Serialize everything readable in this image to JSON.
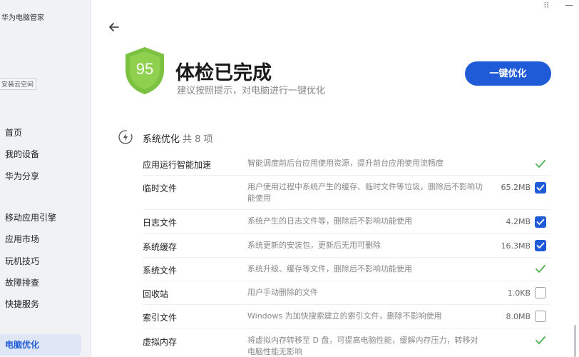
{
  "app": {
    "title": "华为电脑管家",
    "cloud_tag": "安装云空间"
  },
  "sidebar": {
    "items": [
      {
        "label": "首页"
      },
      {
        "label": "我的设备"
      },
      {
        "label": "华为分享"
      },
      {
        "label": "移动应用引擎"
      },
      {
        "label": "应用市场"
      },
      {
        "label": "玩机技巧"
      },
      {
        "label": "故障排查"
      },
      {
        "label": "快捷服务"
      },
      {
        "label": "电脑优化",
        "active": true
      }
    ]
  },
  "checkup": {
    "score": "95",
    "title": "体检已完成",
    "subtitle": "建议按照提示，对电脑进行一键优化",
    "optimize_label": "一键优化"
  },
  "section": {
    "title": "系统优化",
    "count": "共 8 项"
  },
  "rows": [
    {
      "name": "应用运行智能加速",
      "desc": "智能调度前后台应用使用资源，提升前台应用使用流畅度",
      "size": "",
      "state": "done"
    },
    {
      "name": "临时文件",
      "desc": "用户使用过程中系统产生的缓存、临时文件等垃圾，删除后不影响功能使用",
      "size": "65.2MB",
      "state": "checked"
    },
    {
      "name": "日志文件",
      "desc": "系统产生的日志文件等，删除后不影响功能使用",
      "size": "4.2MB",
      "state": "checked"
    },
    {
      "name": "系统缓存",
      "desc": "系统更新的安装包，更新后无用可删除",
      "size": "16.3MB",
      "state": "checked"
    },
    {
      "name": "系统文件",
      "desc": "系统升级、缓存等文件，删除后不影响功能使用",
      "size": "",
      "state": "done"
    },
    {
      "name": "回收站",
      "desc": "用户手动删除的文件",
      "size": "1.0KB",
      "state": "unchecked"
    },
    {
      "name": "索引文件",
      "desc": "Windows 为加快搜索建立的索引文件，删除不影响使用",
      "size": "8.0MB",
      "state": "unchecked"
    },
    {
      "name": "虚拟内存",
      "desc": "将虚拟内存转移至 D 盘，可提高电脑性能，缓解内存压力，转移对电脑性能无影响",
      "size": "",
      "state": "done"
    }
  ],
  "colors": {
    "accent": "#1f5bd6",
    "success": "#4cb050",
    "shield": "#7cc242"
  }
}
